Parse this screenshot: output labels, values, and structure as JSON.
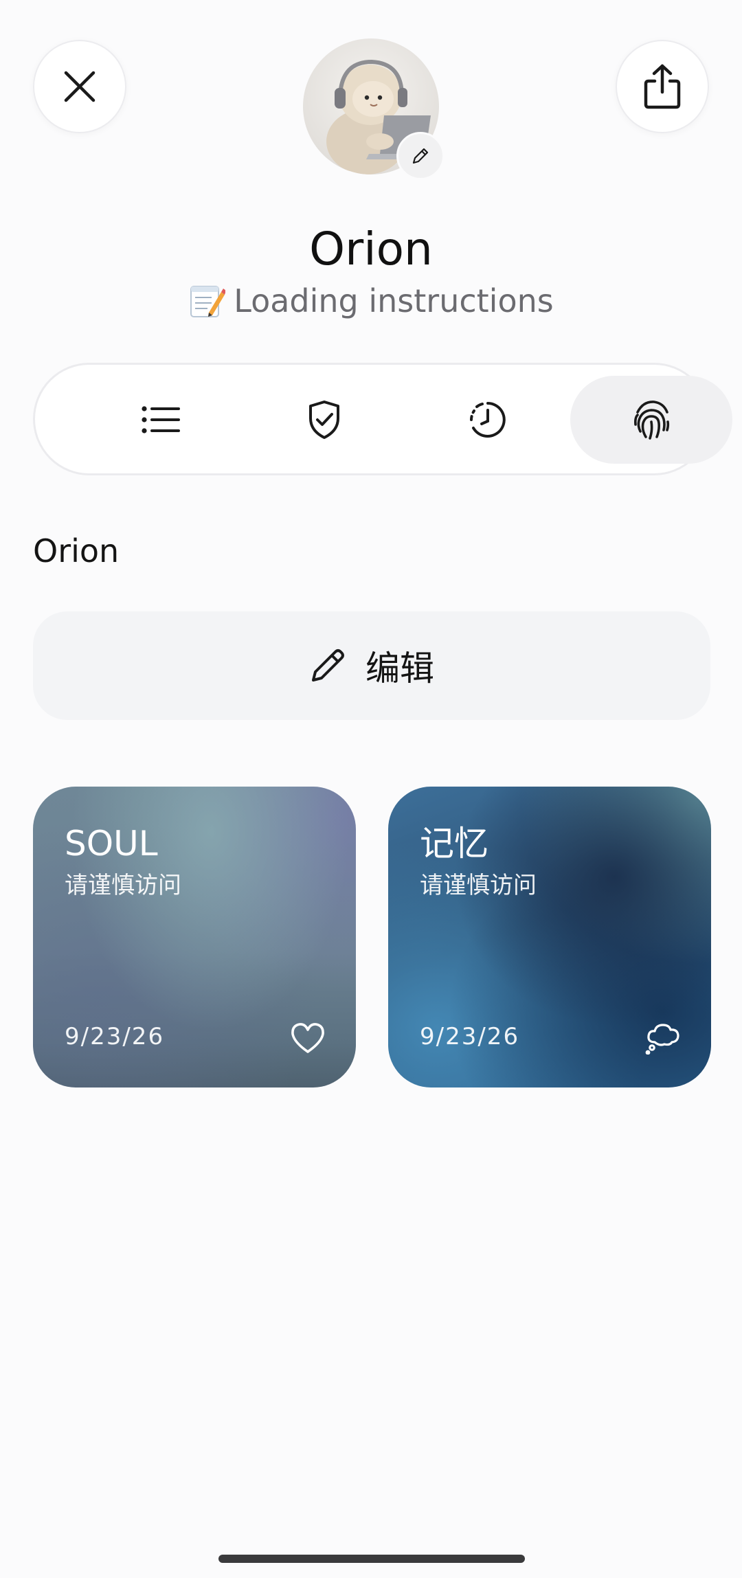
{
  "header": {
    "close_icon": "close-icon",
    "share_icon": "share-icon",
    "avatar_edit_icon": "pencil-icon"
  },
  "agent": {
    "name": "Orion",
    "status_emoji": "memo-icon",
    "status_text": "Loading instructions"
  },
  "tabs": [
    {
      "icon": "list-icon",
      "active": false
    },
    {
      "icon": "shield-check-icon",
      "active": false
    },
    {
      "icon": "clock-history-icon",
      "active": false
    },
    {
      "icon": "fingerprint-icon",
      "active": true
    }
  ],
  "section": {
    "label": "Orion"
  },
  "edit_button": {
    "icon": "pencil-icon",
    "label": "编辑"
  },
  "cards": [
    {
      "title": "SOUL",
      "subtitle": "请谨慎访问",
      "date": "9/23/26",
      "icon": "heart-icon"
    },
    {
      "title": "记忆",
      "subtitle": "请谨慎访问",
      "date": "9/23/26",
      "icon": "thought-bubble-icon"
    }
  ]
}
